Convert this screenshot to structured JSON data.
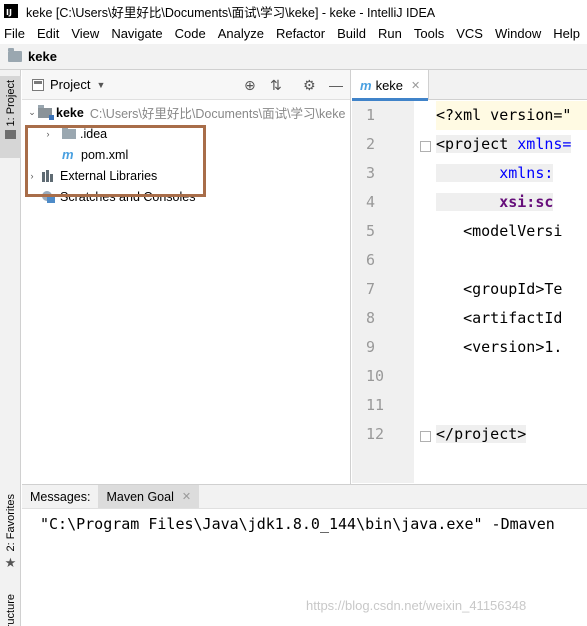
{
  "window": {
    "title": "keke [C:\\Users\\好里好比\\Documents\\面试\\学习\\keke] - keke - IntelliJ IDEA",
    "app_icon_label": "IJ"
  },
  "menu": [
    "File",
    "Edit",
    "View",
    "Navigate",
    "Code",
    "Analyze",
    "Refactor",
    "Build",
    "Run",
    "Tools",
    "VCS",
    "Window",
    "Help"
  ],
  "navbar": {
    "project_label": "keke"
  },
  "left_stripe": {
    "project_tab": "1: Project",
    "favorites_tab": "2: Favorites",
    "structure_tab": "Structure"
  },
  "project_panel": {
    "title": "Project",
    "tree": {
      "root_name": "keke",
      "root_path": "C:\\Users\\好里好比\\Documents\\面试\\学习\\keke",
      "idea_folder": ".idea",
      "pom_file": "pom.xml",
      "external_libraries": "External Libraries",
      "scratches": "Scratches and Consoles"
    }
  },
  "editor": {
    "tab_label": "keke",
    "line_numbers": [
      "1",
      "2",
      "3",
      "4",
      "5",
      "6",
      "7",
      "8",
      "9",
      "10",
      "11",
      "12"
    ],
    "code": {
      "l1": "<?xml version=\"",
      "l2a": "<project",
      "l2b": " xmlns=",
      "l3": "xmlns:",
      "l4": "xsi:sc",
      "l5a": "<",
      "l5b": "modelVersi",
      "l7a": "<",
      "l7b": "groupId",
      "l7c": ">Te",
      "l8a": "<",
      "l8b": "artifactId",
      "l9a": "<",
      "l9b": "version",
      "l9c": ">1.",
      "l12a": "</",
      "l12b": "project",
      "l12c": ">"
    }
  },
  "bottom": {
    "messages_label": "Messages:",
    "maven_goal_tab": "Maven Goal",
    "console_line": "\"C:\\Program Files\\Java\\jdk1.8.0_144\\bin\\java.exe\" -Dmaven"
  },
  "watermark": "https://blog.csdn.net/weixin_41156348",
  "colors": {
    "highlight_box": "#a86d49",
    "tab_underline": "#4083c9",
    "maven_icon": "#4aa0e0"
  }
}
